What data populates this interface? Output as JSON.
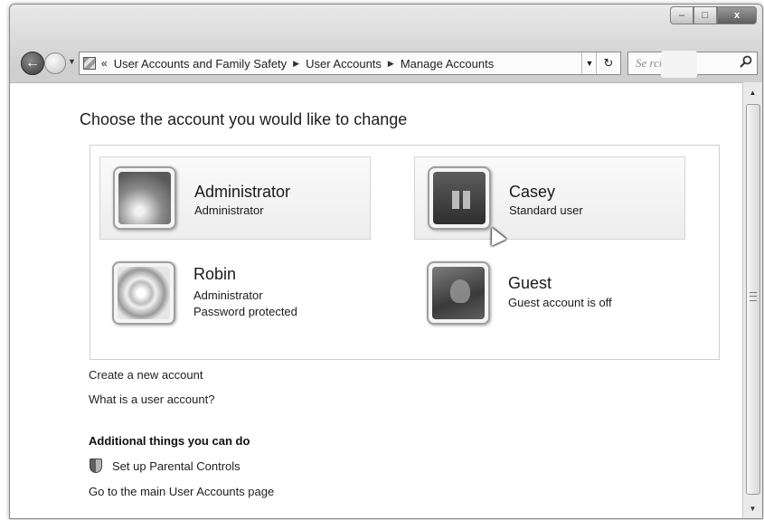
{
  "window": {
    "minimize_glyph": "–",
    "maximize_glyph": "□",
    "close_glyph": "x"
  },
  "navigation": {
    "back_glyph": "←",
    "dropdown_glyph": "▼",
    "breadcrumb_prefix": "«",
    "breadcrumbs": [
      "User Accounts and Family Safety",
      "User Accounts",
      "Manage Accounts"
    ],
    "separator_glyph": "▶",
    "refresh_glyph": "↻",
    "search_placeholder": "Se  rch Co"
  },
  "main": {
    "title": "Choose the account you would like to change",
    "accounts": [
      {
        "name": "Administrator",
        "lines": [
          "Administrator"
        ],
        "picture": "daisy",
        "boxed": true
      },
      {
        "name": "Casey",
        "lines": [
          "Standard user"
        ],
        "picture": "chessboard",
        "boxed": true
      },
      {
        "name": "Robin",
        "lines": [
          "Administrator",
          "Password protected"
        ],
        "picture": "satellite-dish",
        "boxed": false
      },
      {
        "name": "Guest",
        "lines": [
          "Guest account is off"
        ],
        "picture": "guest-briefcase",
        "boxed": false
      }
    ],
    "links": {
      "create_account": "Create a new account",
      "what_is_account": "What is a user account?"
    },
    "additional": {
      "heading": "Additional things you can do",
      "parental_controls": "Set up Parental Controls",
      "main_page": "Go to the main User Accounts page"
    }
  },
  "scrollbar": {
    "up_glyph": "▲",
    "down_glyph": "▼"
  },
  "icons": {
    "search": "search-icon",
    "shield": "shield-icon",
    "control-panel": "control-panel-icon"
  }
}
